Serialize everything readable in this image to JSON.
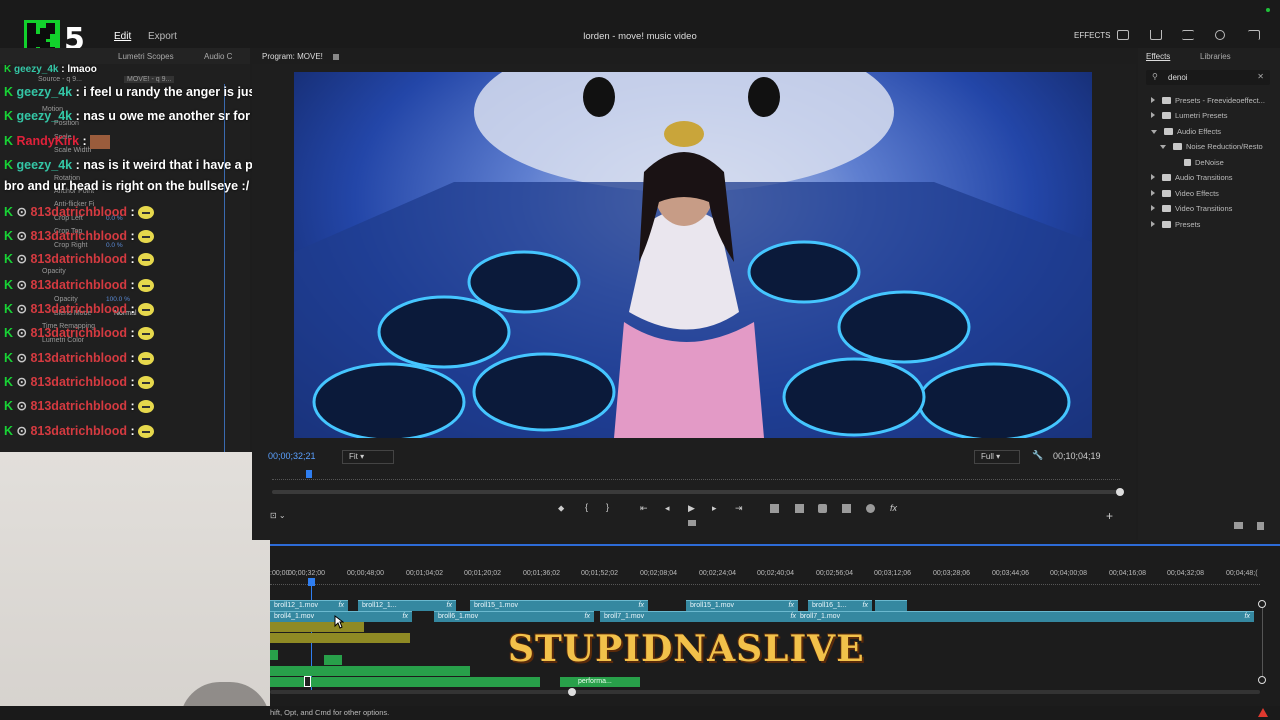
{
  "app": {
    "title": "lorden - move! music video",
    "menu": {
      "edit": "Edit",
      "export": "Export"
    },
    "effects_label": "EFFECTS"
  },
  "stream": {
    "logo_number": "5",
    "overlay_text": "STUPIDNASLIVE"
  },
  "panels": {
    "left_tabs": [
      "Lumetri Scopes",
      "Audio C"
    ],
    "program_tab": "Program: MOVE!",
    "effects_tabs": [
      "Effects",
      "Libraries"
    ]
  },
  "effect_controls": {
    "source": "Source - q 9...",
    "clip": "MOVE! - q 9...",
    "rows": [
      "Motion",
      "Position",
      "Scale",
      "Scale Width",
      "Rotation",
      "Anchor Point",
      "Anti-flicker Fi",
      "Crop Left",
      "Crop Top",
      "Crop Right",
      "Opacity",
      "Opacity",
      "Blend Mode",
      "Time Remapping",
      "Lumetri Color"
    ],
    "values": [
      "0.0 %",
      "0.0 %",
      "100.0 %",
      "Normal"
    ]
  },
  "chat": [
    {
      "user": "geezy_4k",
      "msg": "lmaoo"
    },
    {
      "user": "geezy_4k",
      "msg": "i feel u randy the anger is just to much to handle sometimes"
    },
    {
      "user": "geezy_4k",
      "msg": "nas u owe me another sr for the other day"
    },
    {
      "user": "RandyKirk",
      "msg": ""
    },
    {
      "user": "geezy_4k",
      "msg": "nas is it weird that i have a picture of you on my dartboard"
    },
    {
      "user": "",
      "msg": "bro and ur head is right on the bullseye :/"
    },
    {
      "user": "813datrichblood",
      "msg": ""
    },
    {
      "user": "813datrichblood",
      "msg": ""
    },
    {
      "user": "813datrichblood",
      "msg": ""
    },
    {
      "user": "813datrichblood",
      "msg": ""
    },
    {
      "user": "813datrichblood",
      "msg": ""
    },
    {
      "user": "813datrichblood",
      "msg": ""
    },
    {
      "user": "813datrichblood",
      "msg": ""
    },
    {
      "user": "813datrichblood",
      "msg": ""
    },
    {
      "user": "813datrichblood",
      "msg": ""
    }
  ],
  "monitor": {
    "timecode_current": "00;00;32;21",
    "fit": "Fit",
    "quality": "Full",
    "timecode_duration": "00;10;04;19"
  },
  "effects_panel": {
    "search": "denoi",
    "tree": [
      "Presets - Freevideoeffect...",
      "Lumetri Presets",
      "Audio Effects",
      "Noise Reduction/Resto",
      "DeNoise",
      "Audio Transitions",
      "Video Effects",
      "Video Transitions",
      "Presets"
    ]
  },
  "timeline": {
    "ticks": [
      ":00;00",
      "00;00;32;00",
      "00;00;48;00",
      "00;01;04;02",
      "00;01;20;02",
      "00;01;36;02",
      "00;01;52;02",
      "00;02;08;04",
      "00;02;24;04",
      "00;02;40;04",
      "00;02;56;04",
      "00;03;12;06",
      "00;03;28;06",
      "00;03;44;06",
      "00;04;00;08",
      "00;04;16;08",
      "00;04;32;08",
      "00;04;48;("
    ],
    "v2_clips": [
      "broll12_1.mov",
      "broll12_1...",
      "broll15_1.mov",
      "broll15_1.mov",
      "broll16_1..."
    ],
    "v1_clips": [
      "broll4_1.mov",
      "broll6_1.mov",
      "broll7_1.mov",
      "broll7_1.mov"
    ],
    "audio_clip": "performa..."
  },
  "status_bar": "hift, Opt, and Cmd for other options."
}
